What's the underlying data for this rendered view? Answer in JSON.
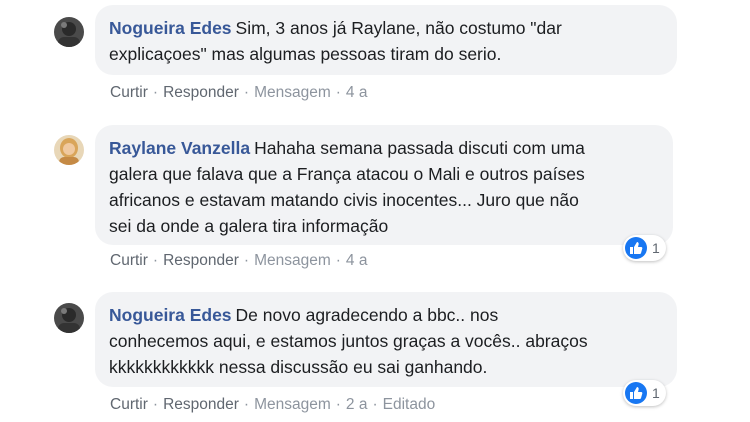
{
  "comments": [
    {
      "author": "Nogueira Edes",
      "text_lines": [
        "Sim, 3 anos já Raylane, não costumo \"dar",
        "explicaçoes\" mas algumas pessoas tiram do serio."
      ],
      "actions": {
        "like": "Curtir",
        "reply": "Responder",
        "message": "Mensagem",
        "time": "4 a"
      }
    },
    {
      "author": "Raylane Vanzella",
      "text_lines": [
        "Hahaha semana passada discuti com uma",
        "galera que falava que a França atacou o Mali e outros países",
        "africanos e estavam matando civis inocentes... Juro que não",
        "sei da onde a galera tira informação"
      ],
      "actions": {
        "like": "Curtir",
        "reply": "Responder",
        "message": "Mensagem",
        "time": "4 a"
      },
      "reaction_count": "1"
    },
    {
      "author": "Nogueira Edes",
      "text_lines": [
        "De novo agradecendo a bbc.. nos",
        "conhecemos aqui, e estamos juntos graças a vocês.. abraços",
        "kkkkkkkkkkkk nessa discussão eu sai ganhando."
      ],
      "actions": {
        "like": "Curtir",
        "reply": "Responder",
        "message": "Mensagem",
        "time": "2 a",
        "edited": "Editado"
      },
      "reaction_count": "1"
    }
  ],
  "icons": {
    "reaction": "like-thumb-icon"
  },
  "colors": {
    "author": "#385898",
    "bubble": "#f2f3f5",
    "like_blue": "#1877f2"
  }
}
